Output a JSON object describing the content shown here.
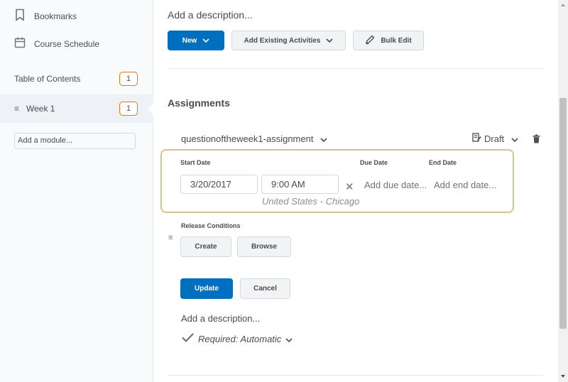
{
  "sidebar": {
    "bookmarks_label": "Bookmarks",
    "schedule_label": "Course Schedule",
    "toc_label": "Table of Contents",
    "toc_count": "1",
    "module_label": "Week 1",
    "module_count": "1",
    "add_module_placeholder": "Add a module..."
  },
  "main": {
    "top_description": "Add a description...",
    "new_button": "New",
    "add_existing_button": "Add Existing Activities",
    "bulk_edit_button": "Bulk Edit",
    "section_title": "Assignments",
    "topic_title": "questionoftheweek1-assignment",
    "status": "Draft",
    "dates": {
      "start_label": "Start Date",
      "due_label": "Due Date",
      "end_label": "End Date",
      "start_date": "3/20/2017",
      "start_time": "9:00 AM",
      "timezone": "United States - Chicago",
      "due_placeholder": "Add due date...",
      "end_placeholder": "Add end date..."
    },
    "release_conditions_label": "Release Conditions",
    "create_button": "Create",
    "browse_button": "Browse",
    "update_button": "Update",
    "cancel_button": "Cancel",
    "bottom_description": "Add a description...",
    "completion": "Required: Automatic"
  },
  "colors": {
    "primary": "#006fbf",
    "badge_border": "#e87511",
    "highlight_border": "#d6c28f"
  },
  "icons": [
    "bookmark-icon",
    "calendar-icon",
    "drag-handle-icon",
    "chevron-down-icon",
    "pencil-icon",
    "draft-icon",
    "trash-icon",
    "close-icon",
    "checkmark-icon"
  ]
}
